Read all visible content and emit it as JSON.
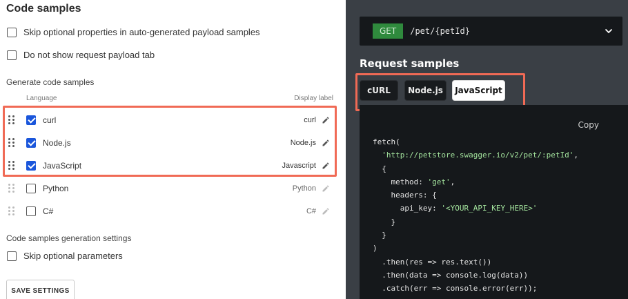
{
  "left": {
    "title": "Code samples",
    "options": [
      {
        "label": "Skip optional properties in auto-generated payload samples",
        "checked": false
      },
      {
        "label": "Do not show request payload tab",
        "checked": false
      }
    ],
    "generate_label": "Generate code samples",
    "col_language": "Language",
    "col_display": "Display label",
    "languages": [
      {
        "name": "curl",
        "display": "curl",
        "checked": true
      },
      {
        "name": "Node.js",
        "display": "Node.js",
        "checked": true
      },
      {
        "name": "JavaScript",
        "display": "Javascript",
        "checked": true
      },
      {
        "name": "Python",
        "display": "Python",
        "checked": false
      },
      {
        "name": "C#",
        "display": "C#",
        "checked": false
      }
    ],
    "gen_settings_label": "Code samples generation settings",
    "skip_optional_params": "Skip optional parameters",
    "save_label": "SAVE SETTINGS"
  },
  "right": {
    "method": "GET",
    "path": "/pet/{petId}",
    "request_samples_title": "Request samples",
    "tabs": [
      {
        "label": "cURL",
        "active": false
      },
      {
        "label": "Node.js",
        "active": false
      },
      {
        "label": "JavaScript",
        "active": true
      }
    ],
    "copy_label": "Copy",
    "code": {
      "l1": "fetch(",
      "l2_str": "'http://petstore.swagger.io/v2/pet/:petId'",
      "l2_tail": ",",
      "l3": "{",
      "l4_key": "method: ",
      "l4_str": "'get'",
      "l4_tail": ",",
      "l5": "headers: {",
      "l6_key": "api_key: ",
      "l6_str": "'<YOUR_API_KEY_HERE>'",
      "l7": "}",
      "l8": "}",
      "l9": ")",
      "l10": ".then(res => res.text())",
      "l11": ".then(data => console.log(data))",
      "l12": ".catch(err => console.error(err));"
    }
  },
  "colors": {
    "highlight": "#f06a55",
    "checkbox": "#1a56db",
    "method_bg": "#2f8a3d",
    "string": "#a3e39d"
  }
}
